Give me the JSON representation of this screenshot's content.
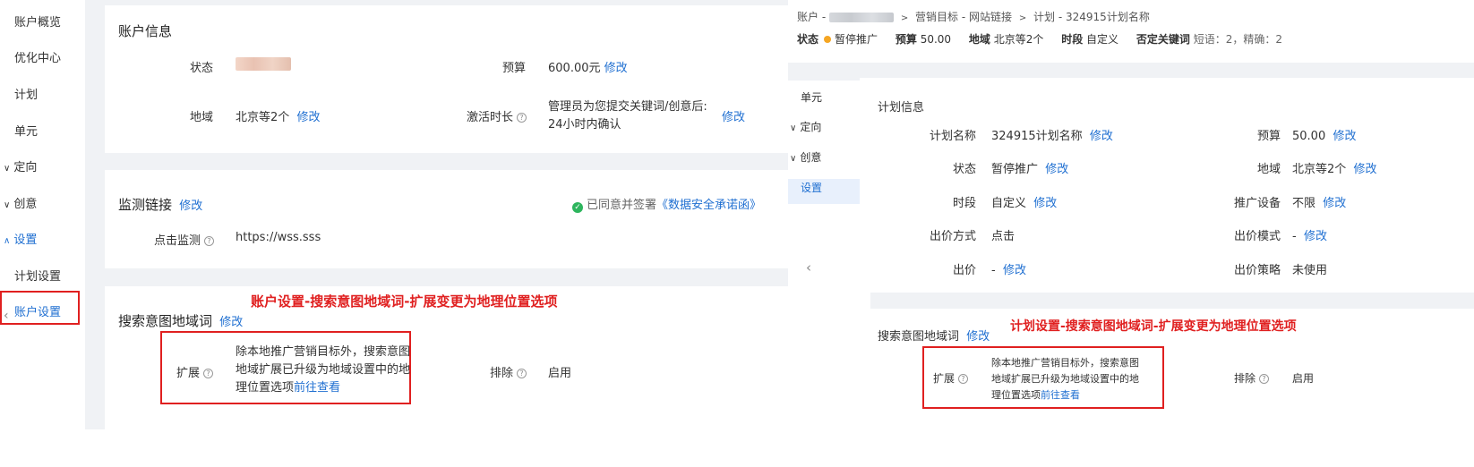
{
  "left": {
    "sidebar": [
      {
        "label": "账户概览",
        "prefix": ""
      },
      {
        "label": "优化中心",
        "prefix": ""
      },
      {
        "label": "计划",
        "prefix": ""
      },
      {
        "label": "单元",
        "prefix": ""
      },
      {
        "label": "定向",
        "prefix": "∨"
      },
      {
        "label": "创意",
        "prefix": "∨"
      },
      {
        "label": "设置",
        "prefix": "∧"
      },
      {
        "label": "计划设置",
        "prefix": ""
      },
      {
        "label": "账户设置",
        "prefix": ""
      }
    ],
    "collapse_glyph": "‹",
    "account_info": {
      "title": "账户信息",
      "status_label": "状态",
      "budget_label": "预算",
      "budget_value": "600.00元",
      "edit": "修改",
      "region_label": "地域",
      "region_value": "北京等2个",
      "activation_label": "激活时长",
      "activation_line1": "管理员为您提交关键词/创意后:",
      "activation_line2": "24小时内确认"
    },
    "monitor": {
      "title": "监测链接",
      "edit": "修改",
      "agreed_text": "已同意并签署",
      "agreement_link": "《数据安全承诺函》",
      "click_label": "点击监测",
      "click_value": "https://wss.sss"
    },
    "search_intent": {
      "title": "搜索意图地域词",
      "edit": "修改",
      "expand_label": "扩展",
      "expand_line1": "除本地推广营销目标外，搜索意图",
      "expand_line2": "地域扩展已升级为地域设置中的地",
      "expand_line3_pre": "理位置选项",
      "expand_link": "前往查看",
      "exclude_label": "排除",
      "exclude_value": "启用"
    },
    "annotation": "账户设置-搜索意图地域词-扩展变更为地理位置选项"
  },
  "right": {
    "breadcrumb": {
      "part1": "账户 -",
      "sep1": ">",
      "part2": "营销目标 - 网站链接",
      "sep2": ">",
      "part3": "计划 - 324915计划名称"
    },
    "summary": {
      "status_label": "状态",
      "status_value": "暂停推广",
      "budget_label": "预算",
      "budget_value": "50.00",
      "region_label": "地域",
      "region_value": "北京等2个",
      "period_label": "时段",
      "period_value": "自定义",
      "neg_label": "否定关键词",
      "neg_value": "短语：2，精确：2"
    },
    "sidebar": [
      {
        "label": "单元",
        "prefix": ""
      },
      {
        "label": "定向",
        "prefix": "∨"
      },
      {
        "label": "创意",
        "prefix": "∨"
      },
      {
        "label": "设置",
        "prefix": ""
      }
    ],
    "collapse_glyph": "‹",
    "plan_info": {
      "title": "计划信息",
      "edit": "修改",
      "name_label": "计划名称",
      "name_value": "324915计划名称",
      "budget_label": "预算",
      "budget_value": "50.00",
      "status_label": "状态",
      "status_value": "暂停推广",
      "region_label": "地域",
      "region_value": "北京等2个",
      "period_label": "时段",
      "period_value": "自定义",
      "device_label": "推广设备",
      "device_value": "不限",
      "bid_method_label": "出价方式",
      "bid_method_value": "点击",
      "bid_mode_label": "出价模式",
      "bid_mode_value": "-",
      "bid_label": "出价",
      "bid_value": "-",
      "strategy_label": "出价策略",
      "strategy_value": "未使用"
    },
    "search_intent": {
      "title": "搜索意图地域词",
      "edit": "修改",
      "expand_label": "扩展",
      "expand_line1": "除本地推广营销目标外，搜索意图",
      "expand_line2": "地域扩展已升级为地域设置中的地",
      "expand_line3_pre": "理位置选项",
      "expand_link": "前往查看",
      "exclude_label": "排除",
      "exclude_value": "启用"
    },
    "annotation": "计划设置-搜索意图地域词-扩展变更为地理位置选项"
  },
  "colors": {
    "link": "#1f6fd1",
    "annotation": "#e02020",
    "status_dot": "#f5a623",
    "check": "#2db55d",
    "page_bg": "#f0f2f5"
  }
}
